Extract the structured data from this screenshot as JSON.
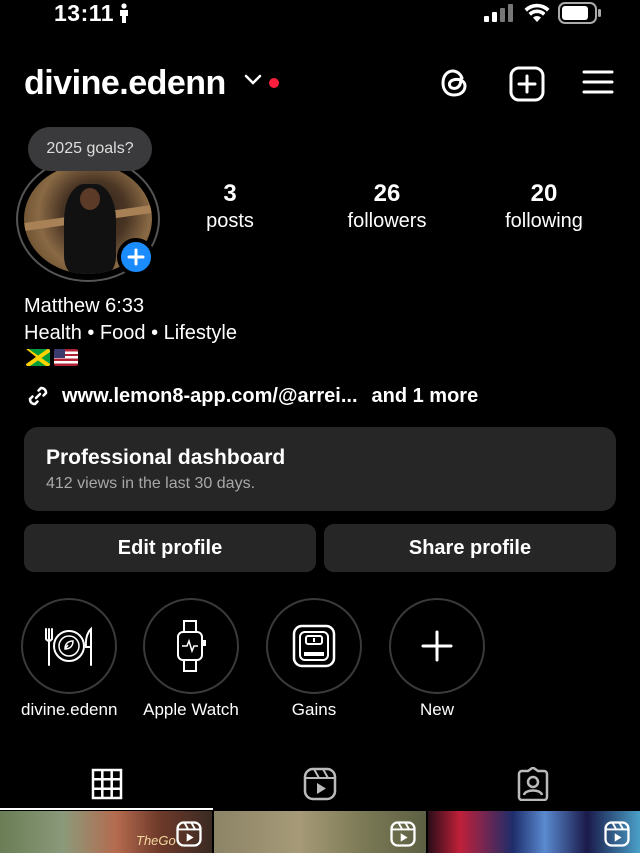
{
  "status_bar": {
    "time": "13:11"
  },
  "header": {
    "username": "divine.edenn"
  },
  "profile": {
    "note": "2025 goals?",
    "stats": [
      {
        "value": "3",
        "label": "posts"
      },
      {
        "value": "26",
        "label": "followers"
      },
      {
        "value": "20",
        "label": "following"
      }
    ],
    "bio_lines": [
      "Matthew 6:33",
      "Health • Food • Lifestyle"
    ],
    "link": {
      "url": "www.lemon8-app.com/@arrei...",
      "more": "and 1 more"
    }
  },
  "dashboard": {
    "title": "Professional dashboard",
    "subtitle": "412 views in the last 30 days."
  },
  "buttons": {
    "edit": "Edit profile",
    "share": "Share profile"
  },
  "highlights": [
    {
      "label": "divine.edenn",
      "icon": "plate-icon"
    },
    {
      "label": "Apple Watch",
      "icon": "watch-icon"
    },
    {
      "label": "Gains",
      "icon": "scale-icon"
    },
    {
      "label": "New",
      "icon": "plus-icon"
    }
  ],
  "tabs": [
    {
      "name": "grid",
      "icon": "grid-icon",
      "active": true
    },
    {
      "name": "reels",
      "icon": "reels-icon",
      "active": false
    },
    {
      "name": "tagged",
      "icon": "tagged-icon",
      "active": false
    }
  ],
  "thumbnails": [
    {
      "text": "TheGo"
    },
    {
      "text": ""
    },
    {
      "text": ""
    }
  ],
  "colors": {
    "background": "#000000",
    "card": "#262626",
    "accent": "#1a8cff",
    "notification_dot": "#ff1f3d"
  }
}
